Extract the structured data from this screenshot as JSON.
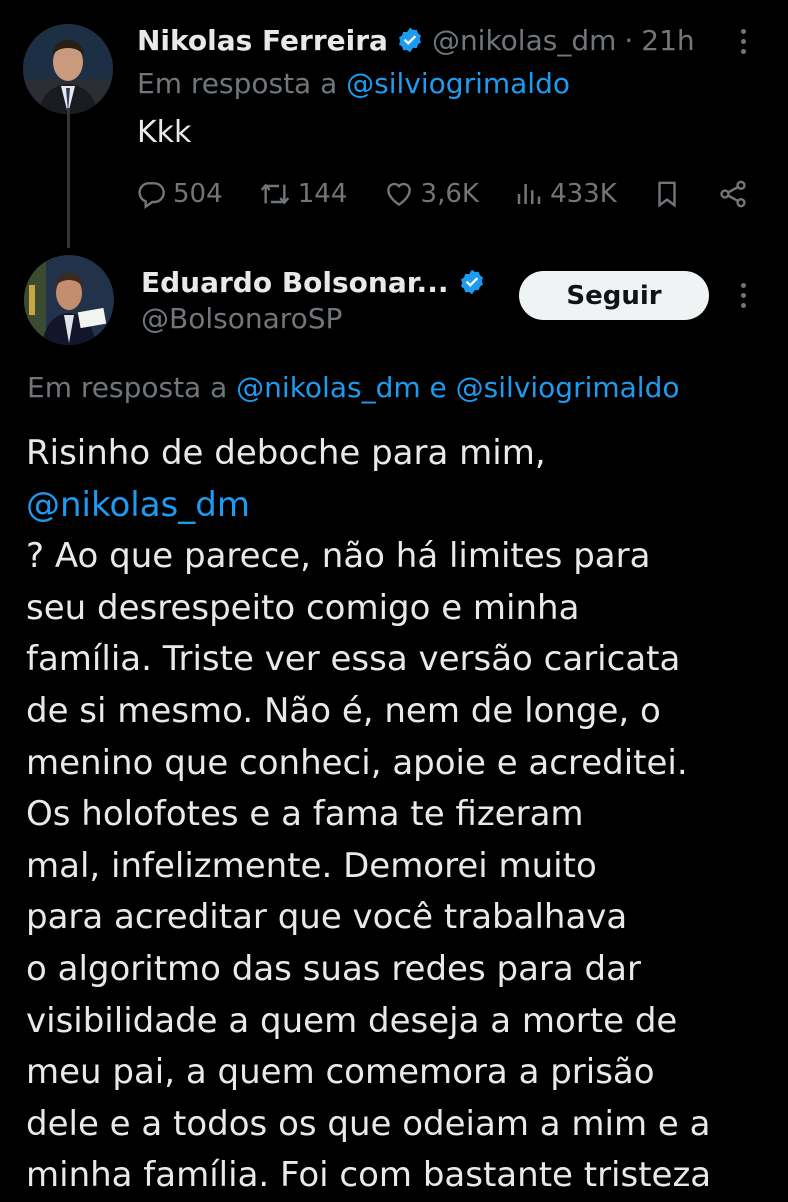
{
  "tweet1": {
    "author_name": "Nikolas Ferreira",
    "handle": "@nikolas_dm",
    "sep": "·",
    "time": "21h",
    "reply_prefix": "Em resposta a",
    "reply_to": "@silviogrimaldo",
    "text": "Kkk",
    "actions": {
      "replies": "504",
      "retweets": "144",
      "likes": "3,6K",
      "views": "433K"
    }
  },
  "tweet2": {
    "author_name": "Eduardo Bolsonar...",
    "handle": "@BolsonaroSP",
    "follow_label": "Seguir",
    "reply_prefix": "Em resposta a",
    "reply_to_1": "@nikolas_dm",
    "reply_conj": "e",
    "reply_to_2": "@silviogrimaldo",
    "text_lines": [
      "Risinho de deboche para mim,",
      "@nikolas_dm",
      "? Ao que parece, não há limites para",
      "seu desrespeito comigo e minha",
      "família. Triste ver essa versão caricata",
      "de si mesmo. Não é, nem de longe, o",
      "menino que conheci, apoie e acreditei.",
      "Os holofotes e a fama te fizeram",
      "mal, infelizmente. Demorei muito",
      "para acreditar que você trabalhava",
      "o algoritmo das suas redes para dar",
      "visibilidade a quem deseja a morte de",
      "meu pai, a quem comemora a prisão",
      "dele e a todos os que odeiam a mim e a",
      "minha família. Foi com bastante tristeza"
    ]
  },
  "colors": {
    "background": "#000000",
    "text": "#e7e9ea",
    "secondary": "#71767b",
    "link": "#1d9bf0",
    "verified": "#1d9bf0"
  }
}
